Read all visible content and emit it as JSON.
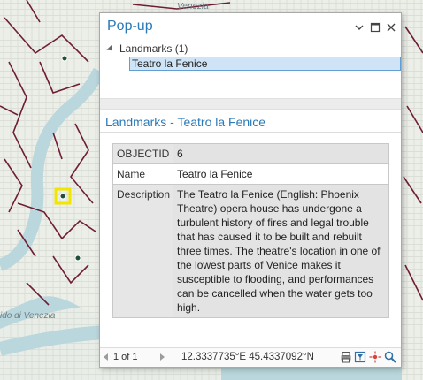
{
  "popup": {
    "title": "Pop-up",
    "window_buttons": {
      "collapse_icon": "chevron-down-icon",
      "maximize_icon": "maximize-icon",
      "close_icon": "close-icon"
    },
    "tree": {
      "layer_label": "Landmarks (1)",
      "selected_feature": "Teatro la Fenice"
    },
    "section_title": "Landmarks - Teatro la Fenice",
    "attributes": [
      {
        "field": "OBJECTID",
        "value": "6"
      },
      {
        "field": "Name",
        "value": "Teatro la Fenice"
      },
      {
        "field": "Description",
        "value": "The Teatro la Fenice (English: Phoenix Theatre) opera house has undergone a turbulent history of fires and legal trouble that has caused it to be built and rebuilt three times. The theatre's location in one of the lowest parts of Venice makes it susceptible to flooding, and performances can be cancelled when the water gets too high."
      }
    ],
    "footer": {
      "page_text": "1 of 1",
      "coordinates": "12.3337735°E 45.4337092°N",
      "icons": [
        "print-icon",
        "filter-icon",
        "flash-icon",
        "zoom-to-icon"
      ]
    }
  },
  "map": {
    "labels": [
      "Venezia",
      "ido di Venezia"
    ],
    "colors": {
      "water": "#b9d7dc",
      "land": "#eef0ea",
      "street": "#6e1d35",
      "highlight": "#f2e500"
    }
  }
}
